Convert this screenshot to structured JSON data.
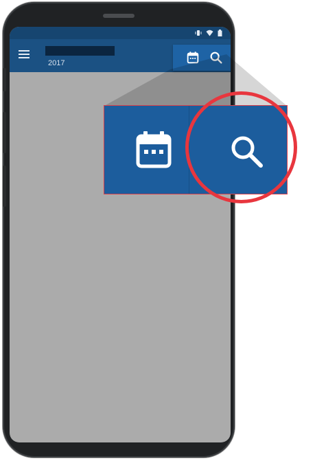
{
  "appbar": {
    "title": "",
    "subtitle": "2017",
    "menu_icon": "menu-icon",
    "actions": [
      {
        "icon": "calendar-icon"
      },
      {
        "icon": "search-icon"
      }
    ]
  },
  "statusbar": {
    "icons": [
      "vibrate-icon",
      "wifi-icon",
      "battery-icon"
    ]
  },
  "zoom_callout": {
    "items": [
      {
        "icon": "calendar-icon"
      },
      {
        "icon": "search-icon",
        "highlighted": true
      }
    ]
  },
  "colors": {
    "statusbar": "#164570",
    "appbar": "#1b5183",
    "action_background": "#1e63a5",
    "content_background": "#ababab",
    "highlight": "#e8363e"
  }
}
